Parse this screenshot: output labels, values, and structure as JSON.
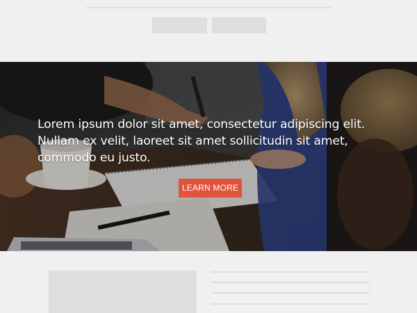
{
  "hero": {
    "text": "Lorem ipsum dolor sit amet, consectetur adipiscing elit. Nullam ex velit, laoreet sit amet sollicitudin sit amet, commodo eu justo.",
    "button_label": "LEARN MORE"
  },
  "colors": {
    "page_background": "#f0f0f0",
    "placeholder_gray": "#dedede",
    "accent_button": "#e0533c",
    "hero_text": "#ffffff"
  }
}
